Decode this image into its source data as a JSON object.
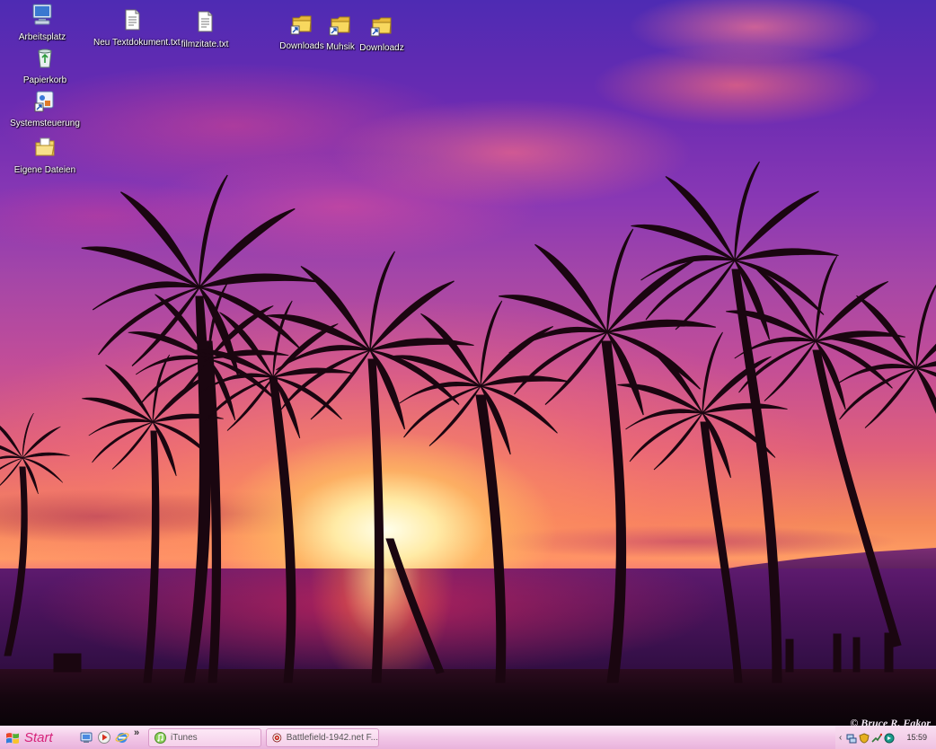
{
  "desktop": {
    "icons": [
      {
        "label": "Arbeitsplatz",
        "icon": "my-computer-icon"
      },
      {
        "label": "Papierkorb",
        "icon": "recycle-bin-icon"
      },
      {
        "label": "Systemsteuerung",
        "icon": "control-panel-shortcut-icon"
      },
      {
        "label": "Eigene Dateien",
        "icon": "my-documents-icon"
      },
      {
        "label": "Neu Textdokument.txt",
        "icon": "text-file-icon"
      },
      {
        "label": "filmzitate.txt",
        "icon": "text-file-icon"
      },
      {
        "label": "Downloads",
        "icon": "folder-shortcut-icon"
      },
      {
        "label": "Muhsik",
        "icon": "folder-shortcut-icon"
      },
      {
        "label": "Downloadz",
        "icon": "folder-shortcut-icon"
      }
    ],
    "watermark": "© Bruce R. Fakor"
  },
  "taskbar": {
    "start_label": "Start",
    "quicklaunch": [
      "show-desktop-icon",
      "media-player-icon",
      "internet-explorer-icon"
    ],
    "quicklaunch_more": "»",
    "tasks": [
      {
        "label": "iTunes",
        "icon": "itunes-icon"
      },
      {
        "label": "Battlefield-1942.net F...",
        "icon": "browser-icon"
      }
    ],
    "tray": {
      "expand": "‹",
      "icons": [
        "network-icon",
        "security-icon",
        "connection-icon",
        "volume-icon"
      ],
      "clock": "15:59"
    }
  }
}
